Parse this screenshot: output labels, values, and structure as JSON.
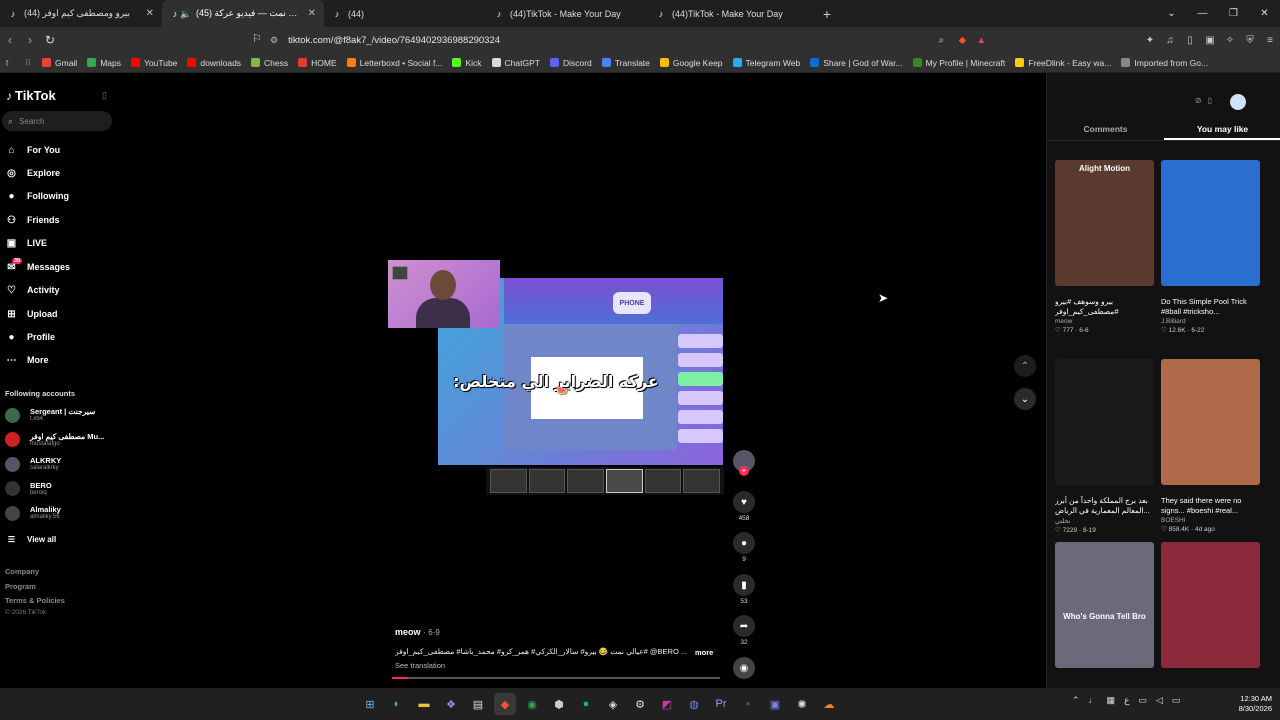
{
  "tabs": [
    {
      "title": "بيرو ومصطفى كيم اوفر (44)",
      "active": false
    },
    {
      "title": "(45) عيالي نمت — فيديو عركة ...",
      "active": true
    },
    {
      "title": "(44)",
      "active": false
    },
    {
      "title": "(44)TikTok - Make Your Day",
      "active": false
    },
    {
      "title": "(44)TikTok - Make Your Day",
      "active": false
    }
  ],
  "address_bar": {
    "url": "tiktok.com/@f8ak7_/video/7649402936988290324"
  },
  "bookmarks": [
    {
      "label": "Gmail",
      "color": "#ea4335"
    },
    {
      "label": "Maps",
      "color": "#34a853"
    },
    {
      "label": "YouTube",
      "color": "#ff0000"
    },
    {
      "label": "downloads",
      "color": "#ff0000"
    },
    {
      "label": "Chess",
      "color": "#81b64c"
    },
    {
      "label": "HOME",
      "color": "#e53935"
    },
    {
      "label": "Letterboxd • Social f...",
      "color": "#ff8000"
    },
    {
      "label": "Kick",
      "color": "#53fc18"
    },
    {
      "label": "ChatGPT",
      "color": "#d9d9d9"
    },
    {
      "label": "Discord",
      "color": "#5865f2"
    },
    {
      "label": "Translate",
      "color": "#4285f4"
    },
    {
      "label": "Google Keep",
      "color": "#fbbc04"
    },
    {
      "label": "Telegram Web",
      "color": "#2aabee"
    },
    {
      "label": "Share | God of War...",
      "color": "#0070d1"
    },
    {
      "label": "My Profile | Minecraft",
      "color": "#3c8527"
    },
    {
      "label": "FreeDlink - Easy wa...",
      "color": "#ffcc00"
    },
    {
      "label": "Imported from Go...",
      "color": "#888888"
    }
  ],
  "sidebar": {
    "logo": "TikTok",
    "search_placeholder": "Search",
    "nav": [
      {
        "label": "For You",
        "icon": "home-icon"
      },
      {
        "label": "Explore",
        "icon": "compass-icon"
      },
      {
        "label": "Following",
        "icon": "avatar-icon"
      },
      {
        "label": "Friends",
        "icon": "friends-icon"
      },
      {
        "label": "LIVE",
        "icon": "live-icon"
      },
      {
        "label": "Messages",
        "icon": "messages-icon",
        "badge": "39"
      },
      {
        "label": "Activity",
        "icon": "activity-icon"
      },
      {
        "label": "Upload",
        "icon": "upload-icon"
      },
      {
        "label": "Profile",
        "icon": "profile-icon"
      },
      {
        "label": "More",
        "icon": "more-icon"
      }
    ],
    "following_header": "Following accounts",
    "following": [
      {
        "name": "Sergeant | سيرجنت",
        "handle": "t.xb4"
      },
      {
        "name": "مصطفى كيم اوفر Mu...",
        "handle": "mustafafgo"
      },
      {
        "name": "ALKRKY",
        "handle": "salaralkrky"
      },
      {
        "name": "BERO",
        "handle": "beroiq"
      },
      {
        "name": "Almaliky",
        "handle": "almaliky.56"
      }
    ],
    "view_all": "View all",
    "footer": [
      "Company",
      "Program",
      "Terms & Policies"
    ],
    "copyright": "© 2026 TikTok"
  },
  "video": {
    "caption": "عركه الضراير الي متخلص:",
    "author": "meow",
    "date": "6-9",
    "description": "عيالي نمت 😂 بيرو# سالار_الكركي# همر_كرو# محمد_باشا# مصطفى_كيم_اوفر# @BERO ...",
    "more": "more",
    "see_translation": "See translation",
    "progress": 0.05,
    "likes": "458",
    "comments": "9",
    "saves": "53",
    "shares": "32"
  },
  "right_panel": {
    "tabs": [
      "Comments",
      "You may like"
    ],
    "active_tab": "You may like",
    "cards": [
      {
        "overlay": "Alight Motion",
        "title": "بيرو وسوهف #بيرو #مصطفى_كيم_اوفر #تكسلوم...",
        "author": "meow",
        "stats": "♡ 777 · 6-6",
        "color": "#5a3a2e"
      },
      {
        "overlay": "",
        "title": "Do This Simple Pool Trick #8ball #tricksho...",
        "author": "J.Billiard",
        "stats": "♡ 12.6K · 6-22",
        "color": "#2a6fd0"
      },
      {
        "overlay": "",
        "title": "بعد برج المملكة واحداً من أبرز المعالم المعمارية في الرياض...",
        "author": "نخلتي",
        "stats": "♡ 7229 · 8-19",
        "color": "#1a1a1a"
      },
      {
        "overlay": "",
        "title": "They said there were no signs... #boeshi #real...",
        "author": "BOESHI",
        "stats": "♡ 858.4K · 4d ago",
        "color": "#b06a4a"
      },
      {
        "overlay": "Who's Gonna Tell Bro",
        "title": "",
        "author": "",
        "stats": "",
        "color": "#6a6a7a"
      },
      {
        "overlay": "",
        "title": "",
        "author": "",
        "stats": "",
        "color": "#8a2a3a"
      }
    ]
  },
  "taskbar": {
    "time": "12:30 AM",
    "date": "8/30/2026",
    "lang": "ع"
  }
}
